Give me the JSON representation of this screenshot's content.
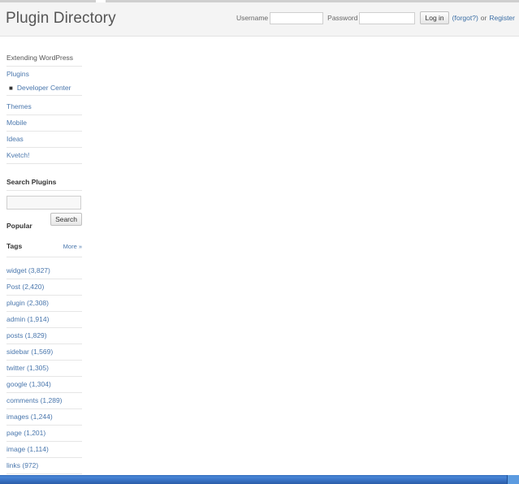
{
  "header": {
    "title": "Plugin Directory",
    "username_label": "Username",
    "username_value": "",
    "password_label": "Password",
    "password_value": "",
    "login_button": "Log in",
    "forgot_link": "(forgot?)",
    "or_text": "or",
    "register_link": "Register"
  },
  "sidebar": {
    "extending": "Extending WordPress",
    "plugins": "Plugins",
    "developer_center": "Developer Center",
    "themes": "Themes",
    "mobile": "Mobile",
    "ideas": "Ideas",
    "kvetch": "Kvetch!"
  },
  "search": {
    "heading": "Search Plugins",
    "input_value": "",
    "button": "Search"
  },
  "tags": {
    "popular": "Popular",
    "title": "Tags",
    "more": "More »",
    "items": [
      "widget (3,827)",
      "Post (2,420)",
      "plugin (2,308)",
      "admin (1,914)",
      "posts (1,829)",
      "sidebar (1,569)",
      "twitter (1,305)",
      "google (1,304)",
      "comments (1,289)",
      "images (1,244)",
      "page (1,201)",
      "image (1,114)",
      "links (972)"
    ]
  },
  "colors": {
    "link": "#4a77ad",
    "header_bg": "#f4f4f4",
    "taskbar": "#2d66b8"
  }
}
